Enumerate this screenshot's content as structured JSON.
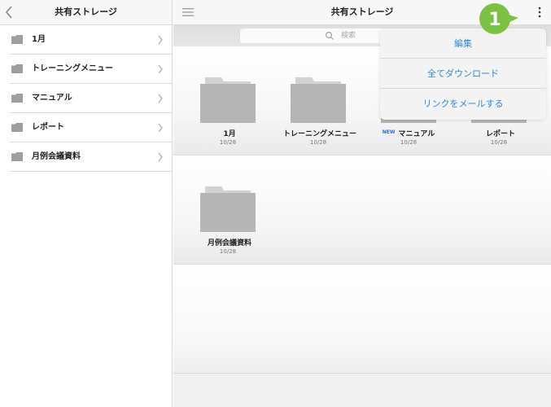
{
  "sidebar": {
    "title": "共有ストレージ",
    "back_icon": "chevron-left-icon",
    "items": [
      {
        "label": "1月"
      },
      {
        "label": "トレーニングメニュー"
      },
      {
        "label": "マニュアル"
      },
      {
        "label": "レポート"
      },
      {
        "label": "月例会議資料"
      }
    ]
  },
  "header": {
    "title": "共有ストレージ",
    "menu_icon": "hamburger-icon",
    "more_icon": "more-vertical-icon"
  },
  "search": {
    "placeholder": "検索"
  },
  "folders": [
    {
      "name": "1月",
      "date": "10/28",
      "badge": ""
    },
    {
      "name": "トレーニングメニュー",
      "date": "10/28",
      "badge": ""
    },
    {
      "name": "マニュアル",
      "date": "10/28",
      "badge": "NEW"
    },
    {
      "name": "レポート",
      "date": "10/28",
      "badge": ""
    },
    {
      "name": "月例会議資料",
      "date": "10/28",
      "badge": ""
    }
  ],
  "dropdown": {
    "items": [
      "編集",
      "全てダウンロード",
      "リンクをメールする"
    ]
  },
  "step_marker": {
    "number": "1",
    "color": "#7cc242"
  },
  "colors": {
    "accent": "#2d8ad8",
    "folder": "#b5b5b5",
    "new_badge": "#2a6fd8"
  }
}
